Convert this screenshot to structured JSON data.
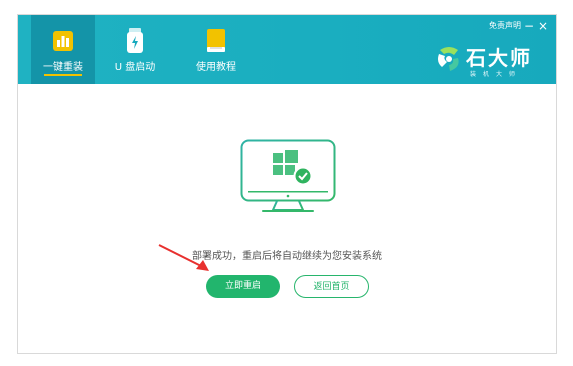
{
  "window": {
    "disclaimer": "免责声明",
    "minimize_glyph": "−",
    "close_glyph": "×"
  },
  "nav": {
    "items": [
      {
        "label": "一键重装",
        "icon": "bar-chart-icon",
        "active": true
      },
      {
        "label": "U 盘启动",
        "icon": "usb-drive-icon",
        "active": false
      },
      {
        "label": "使用教程",
        "icon": "book-icon",
        "active": false
      }
    ]
  },
  "brand": {
    "name": "石大师",
    "subtitle": "装机大师"
  },
  "main": {
    "status_message": "部署成功，重启后将自动继续为您安装系统",
    "restart_button": "立即重启",
    "home_button": "返回首页"
  },
  "colors": {
    "header": "#1fb2c2",
    "active_tab": "#1494a8",
    "accent_yellow": "#f2c200",
    "success_green": "#22b56d",
    "arrow_red": "#e8302e"
  }
}
